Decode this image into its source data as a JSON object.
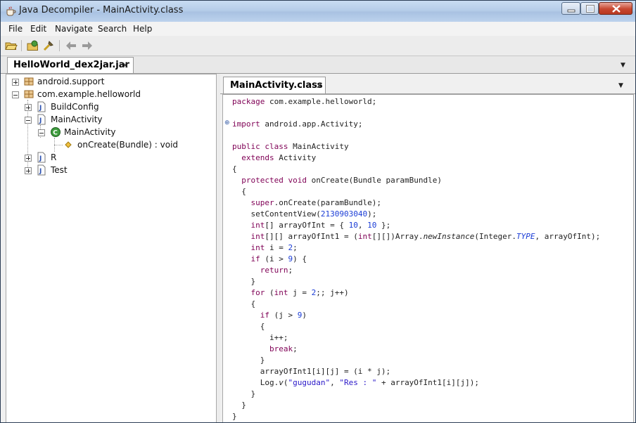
{
  "window": {
    "title": "Java Decompiler - MainActivity.class",
    "controls": {
      "minimize": "minimize",
      "maximize": "maximize",
      "close": "close"
    }
  },
  "menu": [
    "File",
    "Edit",
    "Navigate",
    "Search",
    "Help"
  ],
  "toolbar": {
    "icons": [
      "open-file-icon",
      "open-type-icon",
      "search-icon",
      "back-arrow-icon",
      "forward-arrow-icon"
    ]
  },
  "outer_tab": {
    "label": "HelloWorld_dex2jar.jar",
    "close": "✕"
  },
  "inner_tab": {
    "label": "MainActivity.class",
    "close": "✕"
  },
  "tree": [
    {
      "label": "android.support",
      "icon": "package-icon"
    },
    {
      "label": "com.example.helloworld",
      "icon": "package-icon"
    },
    {
      "label": "BuildConfig",
      "icon": "class-file-icon"
    },
    {
      "label": "MainActivity",
      "icon": "class-file-icon"
    },
    {
      "label": "MainActivity",
      "icon": "class-icon"
    },
    {
      "label": "onCreate(Bundle) : void",
      "icon": "method-icon"
    },
    {
      "label": "R",
      "icon": "class-file-icon"
    },
    {
      "label": "Test",
      "icon": "class-file-icon"
    }
  ],
  "code": [
    [
      [
        "kw",
        "package"
      ],
      [
        "t",
        " com.example.helloworld;"
      ]
    ],
    [],
    [
      [
        "kw",
        "import"
      ],
      [
        "t",
        " android.app.Activity;"
      ]
    ],
    [],
    [
      [
        "kw",
        "public class"
      ],
      [
        "t",
        " MainActivity"
      ]
    ],
    [
      [
        "t",
        "  "
      ],
      [
        "kw",
        "extends"
      ],
      [
        "t",
        " Activity"
      ]
    ],
    [
      [
        "t",
        "{"
      ]
    ],
    [
      [
        "t",
        "  "
      ],
      [
        "kw",
        "protected void"
      ],
      [
        "t",
        " onCreate(Bundle paramBundle)"
      ]
    ],
    [
      [
        "t",
        "  {"
      ]
    ],
    [
      [
        "t",
        "    "
      ],
      [
        "kw",
        "super"
      ],
      [
        "t",
        ".onCreate(paramBundle);"
      ]
    ],
    [
      [
        "t",
        "    setContentView("
      ],
      [
        "num",
        "2130903040"
      ],
      [
        "t",
        ");"
      ]
    ],
    [
      [
        "t",
        "    "
      ],
      [
        "kw",
        "int"
      ],
      [
        "t",
        "[] arrayOfInt = { "
      ],
      [
        "num",
        "10"
      ],
      [
        "t",
        ", "
      ],
      [
        "num",
        "10"
      ],
      [
        "t",
        " };"
      ]
    ],
    [
      [
        "t",
        "    "
      ],
      [
        "kw",
        "int"
      ],
      [
        "t",
        "[][] arrayOfInt1 = ("
      ],
      [
        "kw",
        "int"
      ],
      [
        "t",
        "[][])Array."
      ],
      [
        "it",
        "newInstance"
      ],
      [
        "t",
        "(Integer."
      ],
      [
        "cst",
        "TYPE"
      ],
      [
        "t",
        ", arrayOfInt);"
      ]
    ],
    [
      [
        "t",
        "    "
      ],
      [
        "kw",
        "int"
      ],
      [
        "t",
        " i = "
      ],
      [
        "num",
        "2"
      ],
      [
        "t",
        ";"
      ]
    ],
    [
      [
        "t",
        "    "
      ],
      [
        "kw",
        "if"
      ],
      [
        "t",
        " (i > "
      ],
      [
        "num",
        "9"
      ],
      [
        "t",
        ") {"
      ]
    ],
    [
      [
        "t",
        "      "
      ],
      [
        "kw",
        "return"
      ],
      [
        "t",
        ";"
      ]
    ],
    [
      [
        "t",
        "    }"
      ]
    ],
    [
      [
        "t",
        "    "
      ],
      [
        "kw",
        "for"
      ],
      [
        "t",
        " ("
      ],
      [
        "kw",
        "int"
      ],
      [
        "t",
        " j = "
      ],
      [
        "num",
        "2"
      ],
      [
        "t",
        ";; j++)"
      ]
    ],
    [
      [
        "t",
        "    {"
      ]
    ],
    [
      [
        "t",
        "      "
      ],
      [
        "kw",
        "if"
      ],
      [
        "t",
        " (j > "
      ],
      [
        "num",
        "9"
      ],
      [
        "t",
        ")"
      ]
    ],
    [
      [
        "t",
        "      {"
      ]
    ],
    [
      [
        "t",
        "        i++;"
      ]
    ],
    [
      [
        "t",
        "        "
      ],
      [
        "kw",
        "break"
      ],
      [
        "t",
        ";"
      ]
    ],
    [
      [
        "t",
        "      }"
      ]
    ],
    [
      [
        "t",
        "      arrayOfInt1[i][j] = (i * j);"
      ]
    ],
    [
      [
        "t",
        "      Log."
      ],
      [
        "it",
        "v"
      ],
      [
        "t",
        "("
      ],
      [
        "str",
        "\"gugudan\""
      ],
      [
        "t",
        ", "
      ],
      [
        "str",
        "\"Res : \""
      ],
      [
        "t",
        " + arrayOfInt1[i][j]);"
      ]
    ],
    [
      [
        "t",
        "    }"
      ]
    ],
    [
      [
        "t",
        "  }"
      ]
    ],
    [
      [
        "t",
        "}"
      ]
    ]
  ]
}
